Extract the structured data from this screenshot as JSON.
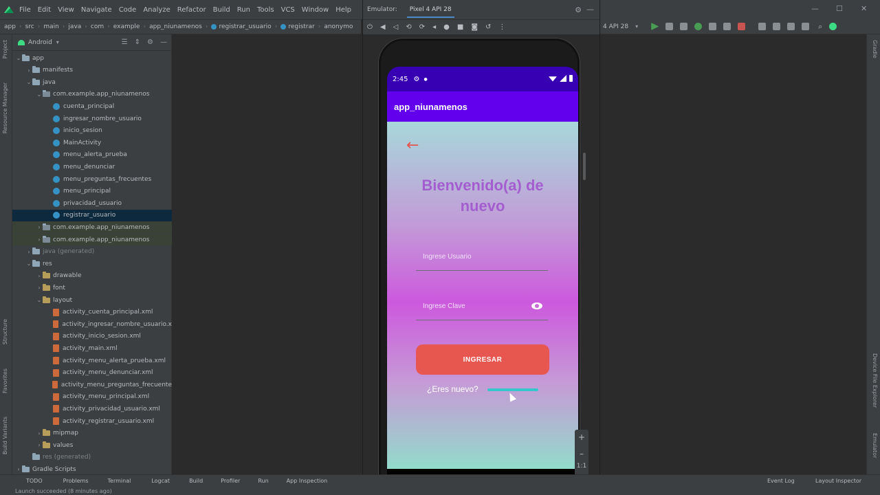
{
  "menu": {
    "items": [
      "File",
      "Edit",
      "View",
      "Navigate",
      "Code",
      "Analyze",
      "Refactor",
      "Build",
      "Run",
      "Tools",
      "VCS",
      "Window",
      "Help"
    ]
  },
  "breadcrumb": {
    "items": [
      "app",
      "src",
      "main",
      "java",
      "com",
      "example",
      "app_niunamenos",
      "registrar_usuario",
      "registrar",
      "anonymo"
    ]
  },
  "emulator": {
    "label": "Emulator:",
    "device_tab": "Pixel 4 API 28"
  },
  "right_toolbar": {
    "device": "4 API 28"
  },
  "project": {
    "view_title": "Android",
    "tree": [
      {
        "label": "app",
        "depth": 0,
        "kind": "module",
        "arrow": "open"
      },
      {
        "label": "manifests",
        "depth": 1,
        "kind": "folder",
        "arrow": "closed"
      },
      {
        "label": "java",
        "depth": 1,
        "kind": "folder",
        "arrow": "open"
      },
      {
        "label": "com.example.app_niunamenos",
        "depth": 2,
        "kind": "pkg",
        "arrow": "open"
      },
      {
        "label": "cuenta_principal",
        "depth": 3,
        "kind": "class"
      },
      {
        "label": "ingresar_nombre_usuario",
        "depth": 3,
        "kind": "class"
      },
      {
        "label": "inicio_sesion",
        "depth": 3,
        "kind": "class"
      },
      {
        "label": "MainActivity",
        "depth": 3,
        "kind": "class"
      },
      {
        "label": "menu_alerta_prueba",
        "depth": 3,
        "kind": "class"
      },
      {
        "label": "menu_denunciar",
        "depth": 3,
        "kind": "class"
      },
      {
        "label": "menu_preguntas_frecuentes",
        "depth": 3,
        "kind": "class"
      },
      {
        "label": "menu_principal",
        "depth": 3,
        "kind": "class"
      },
      {
        "label": "privacidad_usuario",
        "depth": 3,
        "kind": "class"
      },
      {
        "label": "registrar_usuario",
        "depth": 3,
        "kind": "class",
        "selected": true
      },
      {
        "label": "com.example.app_niunamenos",
        "depth": 2,
        "kind": "pkg",
        "arrow": "closed",
        "dim": true
      },
      {
        "label": "com.example.app_niunamenos",
        "depth": 2,
        "kind": "pkg",
        "arrow": "closed",
        "dim": true
      },
      {
        "label": "java (generated)",
        "depth": 1,
        "kind": "folder",
        "arrow": "closed",
        "gray": true
      },
      {
        "label": "res",
        "depth": 1,
        "kind": "folder",
        "arrow": "open"
      },
      {
        "label": "drawable",
        "depth": 2,
        "kind": "res",
        "arrow": "closed"
      },
      {
        "label": "font",
        "depth": 2,
        "kind": "res",
        "arrow": "closed"
      },
      {
        "label": "layout",
        "depth": 2,
        "kind": "res",
        "arrow": "open"
      },
      {
        "label": "activity_cuenta_principal.xml",
        "depth": 3,
        "kind": "xml"
      },
      {
        "label": "activity_ingresar_nombre_usuario.x",
        "depth": 3,
        "kind": "xml"
      },
      {
        "label": "activity_inicio_sesion.xml",
        "depth": 3,
        "kind": "xml"
      },
      {
        "label": "activity_main.xml",
        "depth": 3,
        "kind": "xml"
      },
      {
        "label": "activity_menu_alerta_prueba.xml",
        "depth": 3,
        "kind": "xml"
      },
      {
        "label": "activity_menu_denunciar.xml",
        "depth": 3,
        "kind": "xml"
      },
      {
        "label": "activity_menu_preguntas_frecuente",
        "depth": 3,
        "kind": "xml"
      },
      {
        "label": "activity_menu_principal.xml",
        "depth": 3,
        "kind": "xml"
      },
      {
        "label": "activity_privacidad_usuario.xml",
        "depth": 3,
        "kind": "xml"
      },
      {
        "label": "activity_registrar_usuario.xml",
        "depth": 3,
        "kind": "xml"
      },
      {
        "label": "mipmap",
        "depth": 2,
        "kind": "res",
        "arrow": "closed"
      },
      {
        "label": "values",
        "depth": 2,
        "kind": "res",
        "arrow": "closed"
      },
      {
        "label": "res (generated)",
        "depth": 1,
        "kind": "folder",
        "gray": true
      },
      {
        "label": "Gradle Scripts",
        "depth": 0,
        "kind": "folder",
        "arrow": "closed"
      }
    ]
  },
  "phone": {
    "time": "2:45",
    "app_title": "app_niunamenos",
    "welcome_text": "Bienvenido(a) de nuevo",
    "user_placeholder": "Ingrese Usuario",
    "password_placeholder": "Ingrese Clave",
    "login_button": "INGRESAR",
    "new_user_text": "¿Eres nuevo?"
  },
  "bottom_tools": [
    "TODO",
    "Problems",
    "Terminal",
    "Logcat",
    "Build",
    "Profiler",
    "Run",
    "App Inspection"
  ],
  "bottom_right": [
    "Event Log",
    "Layout Inspector"
  ],
  "status": "Launch succeeded (8 minutes ago)",
  "left_strip_labels": [
    "Project",
    "Resource Manager",
    "Structure",
    "Favorites",
    "Build Variants"
  ],
  "right_strip_labels": [
    "Gradle",
    "Device File Explorer",
    "Emulator"
  ],
  "colors": {
    "accent_purple": "#6200ee",
    "status_purple": "#3700b3",
    "button_red": "#e8574f",
    "welcome_purple": "#a45dcf",
    "link_teal": "#37c6cc"
  }
}
